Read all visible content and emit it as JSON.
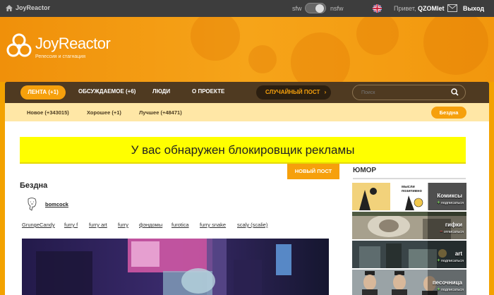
{
  "topbar": {
    "brand": "JoyReactor",
    "sfw": "sfw",
    "nsfw": "nsfw",
    "greeting": "Привет,",
    "username": "QZOMlet",
    "logout": "Выход"
  },
  "header": {
    "site_name": "JoyReactor",
    "tagline": "Репессия и стагнация"
  },
  "nav": {
    "feed": "ЛЕНТА (+1)",
    "discussed": "ОБСУЖДАЕМОЕ (+6)",
    "people": "ЛЮДИ",
    "about": "О ПРОЕКТЕ",
    "random": "СЛУЧАЙНЫЙ ПОСТ",
    "search_placeholder": "Поиск"
  },
  "subnav": {
    "new": "Новое (+343015)",
    "good": "Хорошее (+1)",
    "best": "Лучшее (+48471)",
    "abyss": "Бездна"
  },
  "main": {
    "adblock_notice": "У вас обнаружен блокировщик рекламы",
    "new_post": "НОВЫЙ ПОСТ",
    "page_title": "Бездна",
    "author": "bomcock",
    "tags": [
      "GrungeCandy",
      "furry f",
      "furry art",
      "furry",
      "фэндомы",
      "furotica",
      "furry snake",
      "scaly (scalie)"
    ]
  },
  "sidebar": {
    "heading": "ЮМОР",
    "items": [
      {
        "label": "Комиксы",
        "action": "подписаться",
        "action_sign": "+"
      },
      {
        "label": "гифки",
        "action": "отписаться",
        "action_sign": "−"
      },
      {
        "label": "art",
        "action": "подписаться",
        "action_sign": "+"
      },
      {
        "label": "песочница",
        "action": "подписаться",
        "action_sign": "+"
      }
    ],
    "comic_text": "мысли позитивно"
  },
  "colors": {
    "accent": "#f6a00c",
    "nav_bg": "#4f3a21",
    "subnav_bg": "#ffe7a6",
    "adblock_bg": "#ffff00",
    "topbar_bg": "#3d3d3d"
  }
}
